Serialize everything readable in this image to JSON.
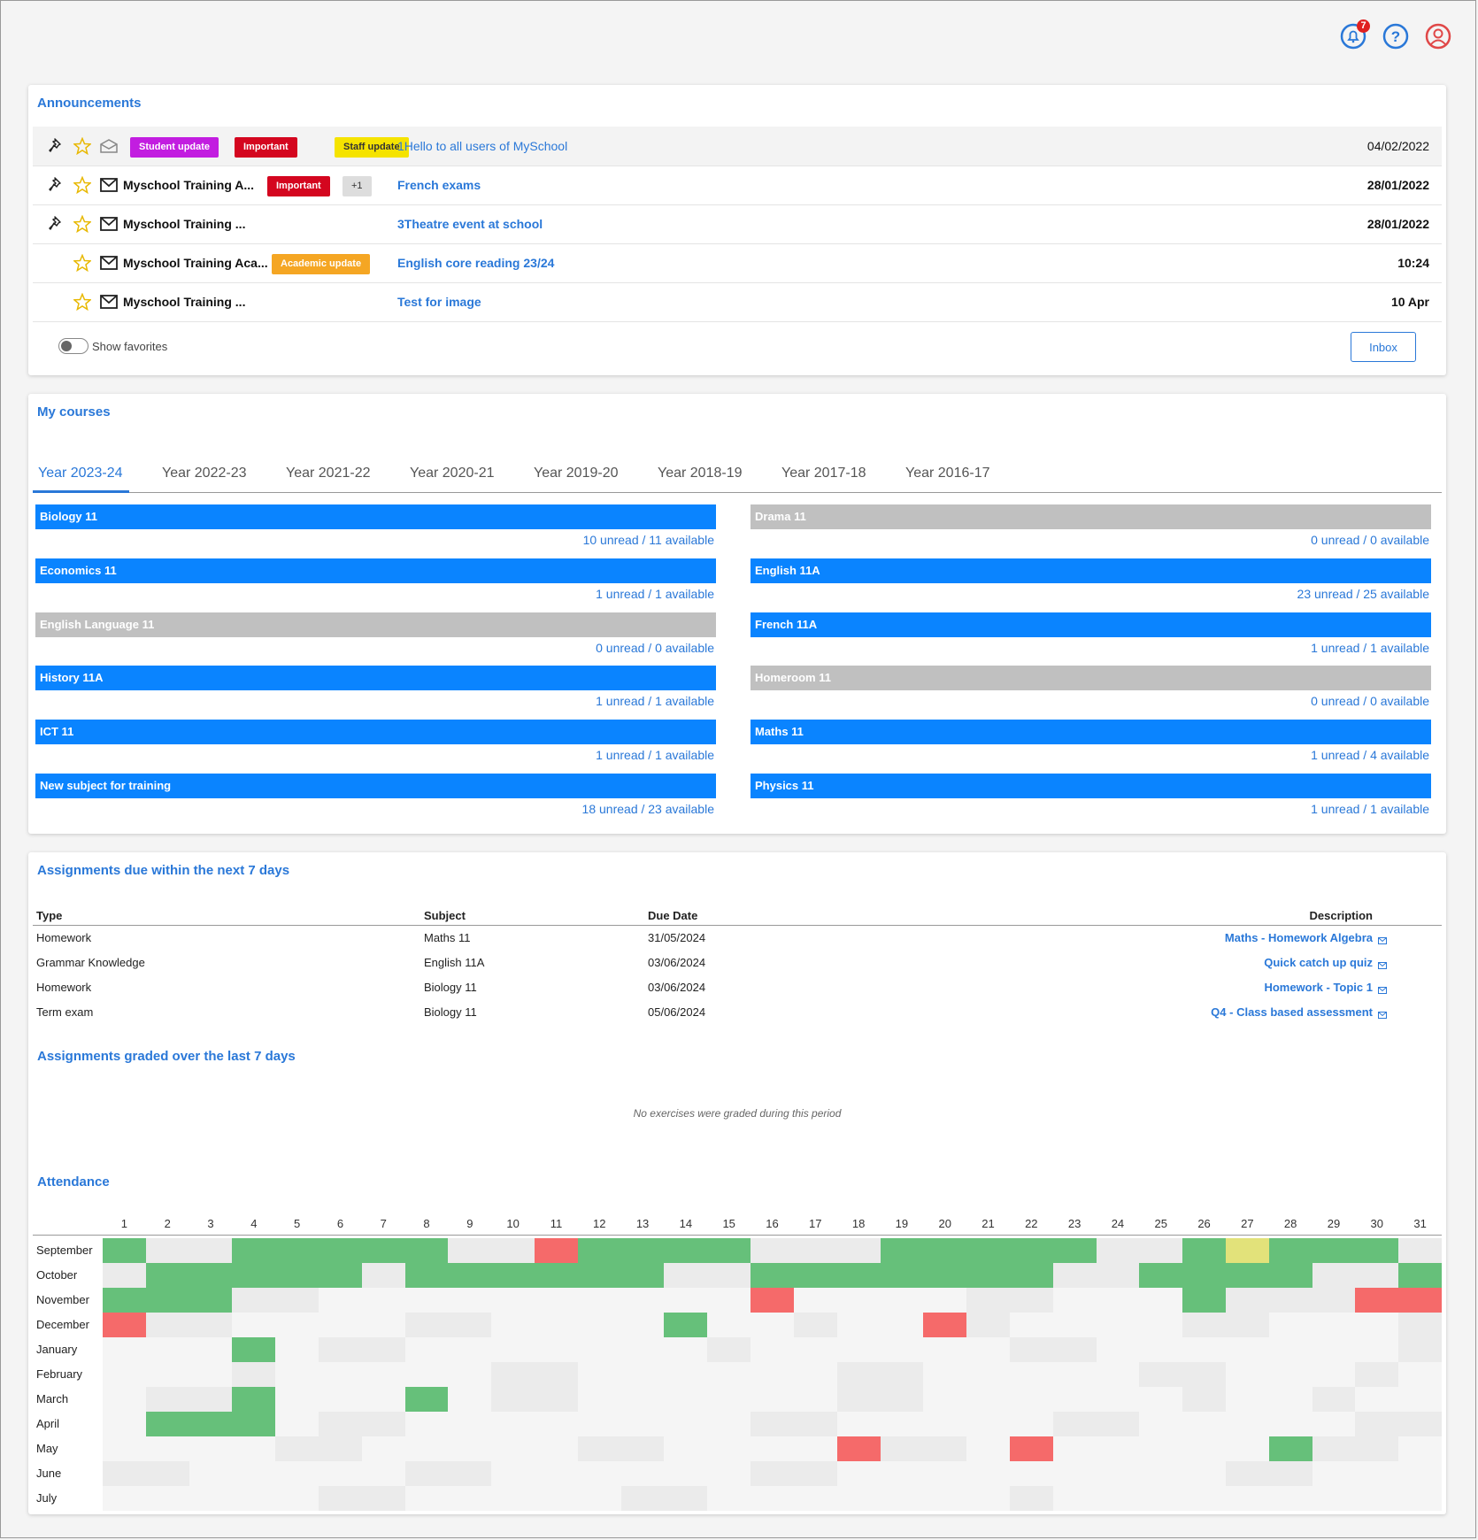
{
  "topbar": {
    "notification_count": "7",
    "icons": [
      "bell-icon",
      "help-icon",
      "user-icon"
    ]
  },
  "announcements": {
    "title": "Announcements",
    "rows": [
      {
        "sender": "",
        "tags": [
          {
            "text": "Student update",
            "color": "#c21de0",
            "fg": "#ffffff"
          },
          {
            "text": "Important",
            "color": "#d4061f",
            "fg": "#ffffff"
          },
          {
            "text": "Staff update",
            "color": "#f5e300",
            "fg": "#333333"
          }
        ],
        "subject": "1Hello to all users of MySchool",
        "date": "04/02/2022",
        "read": true,
        "pinned": true
      },
      {
        "sender": "Myschool Training A...",
        "tags": [
          {
            "text": "Important",
            "color": "#d4061f",
            "fg": "#ffffff"
          },
          {
            "text": "+1",
            "color": "#dddddd",
            "fg": "#333333"
          }
        ],
        "subject": "French exams",
        "date": "28/01/2022",
        "read": false,
        "pinned": true
      },
      {
        "sender": "Myschool Training ...",
        "tags": [],
        "subject": "3Theatre event at school",
        "date": "28/01/2022",
        "read": false,
        "pinned": true
      },
      {
        "sender": "Myschool Training Aca...",
        "tags": [
          {
            "text": "Academic update",
            "color": "#f5a623",
            "fg": "#ffffff"
          }
        ],
        "subject": "English core reading 23/24",
        "date": "10:24",
        "read": false,
        "pinned": false
      },
      {
        "sender": "Myschool Training ...",
        "tags": [],
        "subject": "Test for image",
        "date": "10 Apr",
        "read": false,
        "pinned": false
      }
    ],
    "show_favorites_label": "Show favorites",
    "inbox_label": "Inbox"
  },
  "courses": {
    "title": "My courses",
    "tabs": [
      "Year 2023-24",
      "Year 2022-23",
      "Year 2021-22",
      "Year 2020-21",
      "Year 2019-20",
      "Year 2018-19",
      "Year 2017-18",
      "Year 2016-17"
    ],
    "active_tab": 0,
    "items": [
      {
        "name": "Biology 11",
        "stat": "10 unread / 11 available",
        "color": "blue"
      },
      {
        "name": "Drama 11",
        "stat": "0 unread / 0 available",
        "color": "gray"
      },
      {
        "name": "Economics 11",
        "stat": "1 unread / 1 available",
        "color": "blue"
      },
      {
        "name": "English 11A",
        "stat": "23 unread / 25 available",
        "color": "blue"
      },
      {
        "name": "English Language 11",
        "stat": "0 unread / 0 available",
        "color": "gray"
      },
      {
        "name": "French 11A",
        "stat": "1 unread / 1 available",
        "color": "blue"
      },
      {
        "name": "History 11A",
        "stat": "1 unread / 1 available",
        "color": "blue"
      },
      {
        "name": "Homeroom 11",
        "stat": "0 unread / 0 available",
        "color": "gray"
      },
      {
        "name": "ICT 11",
        "stat": "1 unread / 1 available",
        "color": "blue"
      },
      {
        "name": "Maths 11",
        "stat": "1 unread / 4 available",
        "color": "blue"
      },
      {
        "name": "New subject for training",
        "stat": "18 unread / 23 available",
        "color": "blue"
      },
      {
        "name": "Physics 11",
        "stat": "1 unread / 1 available",
        "color": "blue"
      }
    ]
  },
  "assignments": {
    "title": "Assignments due within the next 7 days",
    "headers": {
      "type": "Type",
      "subject": "Subject",
      "due": "Due Date",
      "description": "Description"
    },
    "rows": [
      {
        "type": "Homework",
        "subject": "Maths 11",
        "due": "31/05/2024",
        "description": "Maths - Homework Algebra"
      },
      {
        "type": "Grammar Knowledge",
        "subject": "English 11A",
        "due": "03/06/2024",
        "description": "Quick catch up quiz"
      },
      {
        "type": "Homework",
        "subject": "Biology 11",
        "due": "03/06/2024",
        "description": "Homework - Topic 1"
      },
      {
        "type": "Term exam",
        "subject": "Biology 11",
        "due": "05/06/2024",
        "description": "Q4 - Class based assessment"
      }
    ]
  },
  "graded": {
    "title": "Assignments graded over the last 7 days",
    "empty_text": "No exercises were graded during this period"
  },
  "attendance": {
    "title": "Attendance",
    "days": [
      "1",
      "2",
      "3",
      "4",
      "5",
      "6",
      "7",
      "8",
      "9",
      "10",
      "11",
      "12",
      "13",
      "14",
      "15",
      "16",
      "17",
      "18",
      "19",
      "20",
      "21",
      "22",
      "23",
      "24",
      "25",
      "26",
      "27",
      "28",
      "29",
      "30",
      "31"
    ],
    "months": [
      "September",
      "October",
      "November",
      "December",
      "January",
      "February",
      "March",
      "April",
      "May",
      "June",
      "July"
    ],
    "legend_colors": {
      "G": "#66c07a",
      "R": "#f56a6a",
      "Y": "#e2e27a",
      "g": "#ebebeb",
      "l": "#f5f5f5",
      "w": "#ffffff"
    },
    "grid": [
      "GggGGGGGggRGGGGgggGGGGGggGYGGGgw",
      "gGGGGGgGGGGGGggGGGGGGGggGGGGggGG",
      "GGGggllllllllllRllllgglllGgggRRRRRw",
      "RggllllggllllGllgllRgllllgglllggg",
      "lllGlgglllllllgllllllgglllllllgl",
      "lllglllllggllllllgglllllgglllgllw",
      "lggGlllGlggllllllggllllllgllgllg",
      "lGGGlggllllllllgglllllgglllllggl",
      "llllgglllllggllllRgglRlllllGgglllRG",
      "gglllllggllllllgglllllllllgglllllllw",
      "lllllgglllllgglllllllglllllllllggl"
    ]
  }
}
